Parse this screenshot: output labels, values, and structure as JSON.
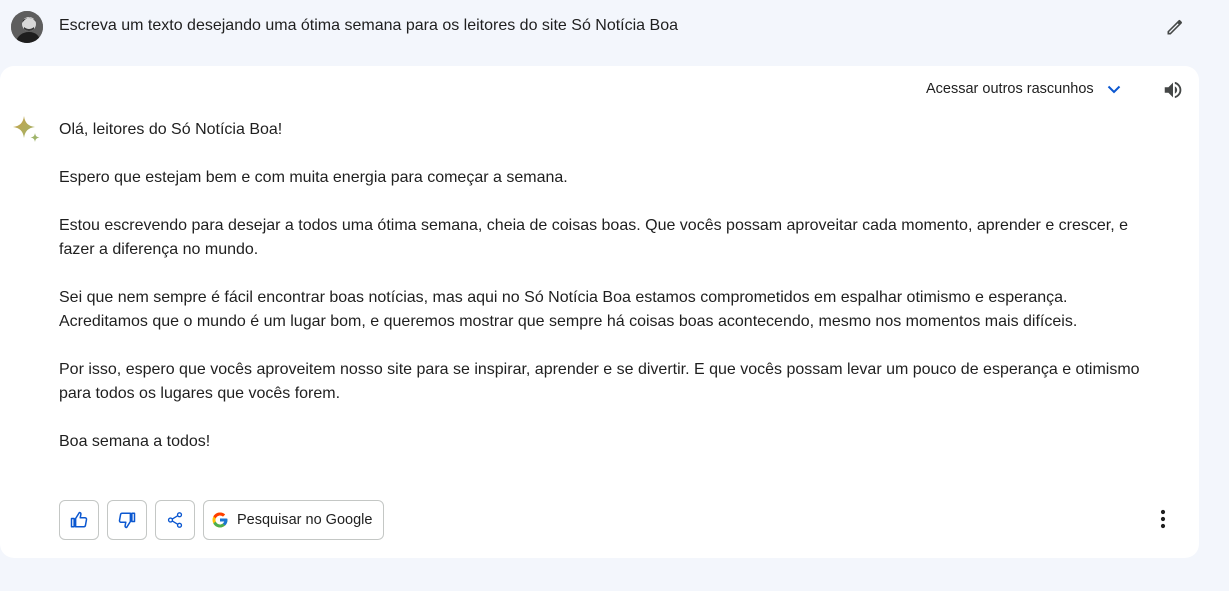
{
  "prompt": {
    "text": "Escreva um texto desejando uma ótima semana para os leitores do site Só Notícia Boa"
  },
  "card": {
    "drafts_label": "Acessar outros rascunhos",
    "paragraphs": [
      "Olá, leitores do Só Notícia Boa!",
      "Espero que estejam bem e com muita energia para começar a semana.",
      "Estou escrevendo para desejar a todos uma ótima semana, cheia de coisas boas. Que vocês possam aproveitar cada momento, aprender e crescer, e fazer a diferença no mundo.",
      "Sei que nem sempre é fácil encontrar boas notícias, mas aqui no Só Notícia Boa estamos comprometidos em espalhar otimismo e esperança. Acreditamos que o mundo é um lugar bom, e queremos mostrar que sempre há coisas boas acontecendo, mesmo nos momentos mais difíceis.",
      "Por isso, espero que vocês aproveitem nosso site para se inspirar, aprender e se divertir. E que vocês possam levar um pouco de esperança e otimismo para todos os lugares que vocês forem.",
      "Boa semana a todos!"
    ],
    "google_search_label": "Pesquisar no Google"
  },
  "icons": {
    "edit": "pencil-icon",
    "speaker": "speaker-icon",
    "chevron": "chevron-down-icon",
    "spark": "gemini-sparkle-icon",
    "thumbs_up": "thumbs-up-icon",
    "thumbs_down": "thumbs-down-icon",
    "share": "share-icon",
    "google": "google-g-icon",
    "more": "more-vert-icon"
  },
  "colors": {
    "page_bg": "#f3f6fc",
    "card_bg": "#ffffff",
    "accent_blue": "#0b57d0",
    "text": "#1f1f1f"
  }
}
